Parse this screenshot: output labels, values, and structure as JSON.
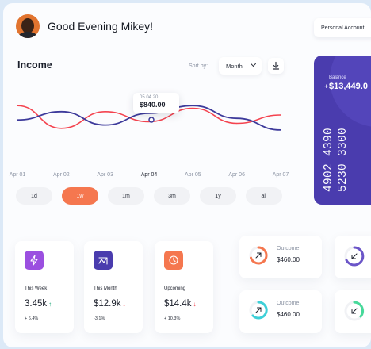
{
  "header": {
    "greeting": "Good Evening Mikey!",
    "account_button": "Personal Account"
  },
  "income": {
    "title": "Income",
    "sort_label": "Sort by:",
    "sort_value": "Month",
    "tooltip": {
      "date": "05.04.20",
      "value": "$840.00"
    },
    "ranges": [
      "1d",
      "1w",
      "1m",
      "3m",
      "1y",
      "all"
    ],
    "active_range": "1w"
  },
  "chart_data": {
    "type": "line",
    "x": [
      "Apr 01",
      "Apr 02",
      "Apr 03",
      "Apr 04",
      "Apr 05",
      "Apr 06",
      "Apr 07"
    ],
    "series": [
      {
        "color": "#f4434f",
        "values": [
          0.78,
          0.1,
          0.6,
          0.3,
          0.7,
          0.25,
          0.5
        ]
      },
      {
        "color": "#3d3a9b",
        "values": [
          0.35,
          0.6,
          0.2,
          0.55,
          0.78,
          0.4,
          0.05
        ]
      }
    ]
  },
  "stats": [
    {
      "label": "This Week",
      "value": "3.45k",
      "direction": "up",
      "change": "+ 6.4%",
      "icon": "lightning-icon",
      "color": "#9b4fe0"
    },
    {
      "label": "This Month",
      "value": "$12.9k",
      "direction": "down",
      "change": "-3.1%",
      "icon": "trend-icon",
      "color": "#4a3cae"
    },
    {
      "label": "Upcoming",
      "value": "$14.4k",
      "direction": "down",
      "change": "+ 10.3%",
      "icon": "clock-icon",
      "color": "#f5774f"
    }
  ],
  "outcomes": [
    {
      "label": "Outcome",
      "amount": "$460.00",
      "color": "#f5774f"
    },
    {
      "label": "Outcome",
      "amount": "$460.00",
      "color": "#3ed0d8"
    }
  ],
  "balance": {
    "label": "Balance",
    "value": "$13,449.0",
    "card_number_1": "4902 4390",
    "card_number_2": "5230 3300"
  },
  "colors": {
    "accent": "#f5774f",
    "primary": "#4a3cae",
    "up": "#1fa87a",
    "down": "#f4434f"
  }
}
